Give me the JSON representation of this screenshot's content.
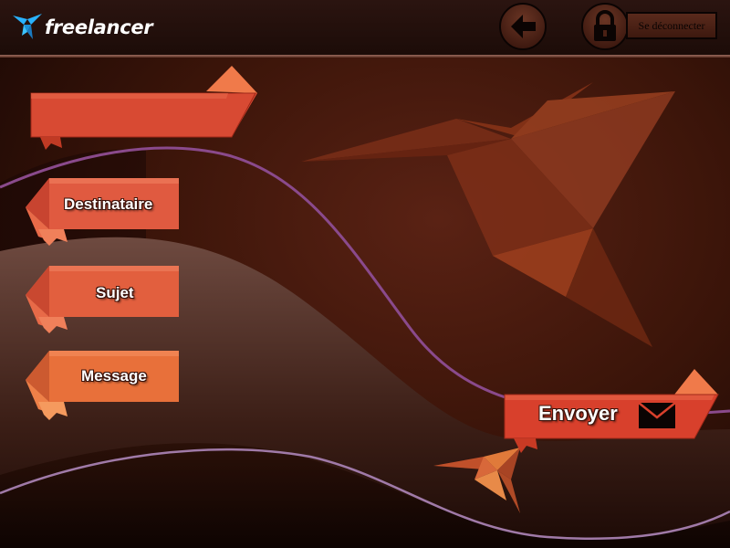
{
  "header": {
    "logo_text": "freelancer",
    "logo_icon": "bird-logo-icon",
    "back_icon": "arrow-left-icon",
    "lock_icon": "lock-icon",
    "logout_label": "Se déconnecter"
  },
  "form": {
    "title_ribbon_text": "",
    "recipient_label": "Destinataire",
    "subject_label": "Sujet",
    "message_label": "Message",
    "send_label": "Envoyer",
    "send_icon": "envelope-icon"
  },
  "colors": {
    "background": "#2a0e08",
    "ribbon_red": "#d84a33",
    "ribbon_orange": "#e86e3a",
    "wave_purple": "#8a4a8c",
    "header_bg": "#1c0c08"
  }
}
